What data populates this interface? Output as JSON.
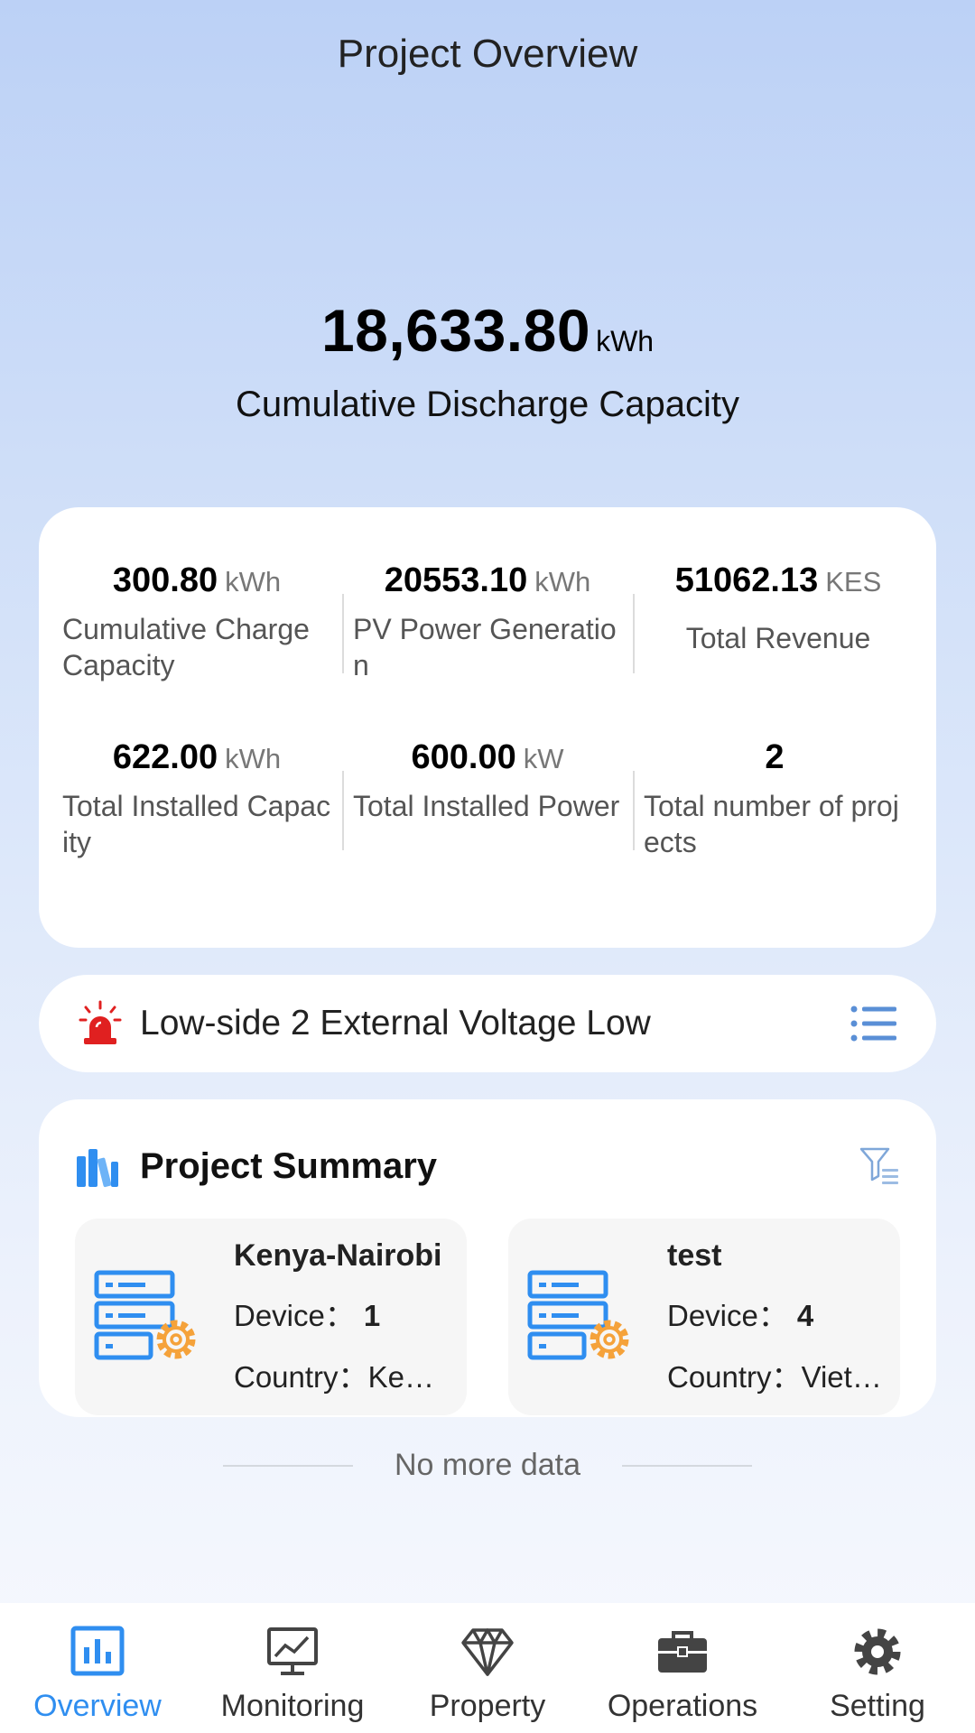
{
  "header": {
    "title": "Project Overview"
  },
  "hero": {
    "value": "18,633.80",
    "unit": "kWh",
    "label": "Cumulative Discharge Capacity"
  },
  "stats": [
    {
      "value": "300.80",
      "unit": "kWh",
      "label": "Cumulative Charge Capacity"
    },
    {
      "value": "20553.10",
      "unit": "kWh",
      "label": "PV Power Generation"
    },
    {
      "value": "51062.13",
      "unit": "KES",
      "label": "Total Revenue"
    },
    {
      "value": "622.00",
      "unit": "kWh",
      "label": "Total Installed Capacity"
    },
    {
      "value": "600.00",
      "unit": "kW",
      "label": "Total Installed Power"
    },
    {
      "value": "2",
      "unit": "",
      "label": "Total number of projects"
    }
  ],
  "alert": {
    "text": "Low-side 2 External Voltage Low",
    "icon": "alarm-siren-icon",
    "color": "#e02020"
  },
  "summary": {
    "title": "Project Summary",
    "device_label": "Device：",
    "country_label": "Country：",
    "projects": [
      {
        "name": "Kenya-Nairobi",
        "devices": "1",
        "country": "Kenya"
      },
      {
        "name": "test",
        "devices": "4",
        "country": "Vietnam"
      }
    ]
  },
  "footer_note": "No more data",
  "tabs": [
    {
      "label": "Overview",
      "icon": "bar-chart-icon",
      "active": true
    },
    {
      "label": "Monitoring",
      "icon": "monitor-chart-icon",
      "active": false
    },
    {
      "label": "Property",
      "icon": "diamond-icon",
      "active": false
    },
    {
      "label": "Operations",
      "icon": "toolbox-icon",
      "active": false
    },
    {
      "label": "Setting",
      "icon": "gear-icon",
      "active": false
    }
  ],
  "colors": {
    "accent": "#2f8ef0",
    "alert": "#e02020",
    "server_icon": "#2f8ef0",
    "gear_accent": "#f5a23a"
  }
}
